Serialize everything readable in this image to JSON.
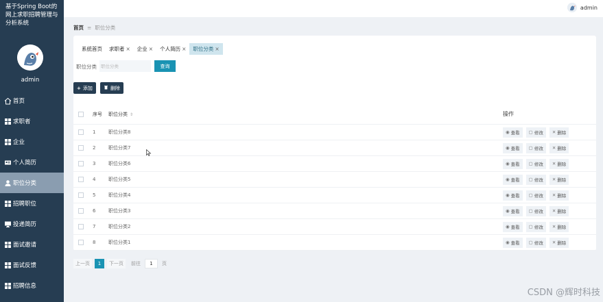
{
  "app": {
    "title": "基于Spring Boot的网上求职招聘管理与分析系统",
    "user_name": "admin",
    "header_user": "admin"
  },
  "sidebar": {
    "items": [
      {
        "label": "首页",
        "icon": "home-icon"
      },
      {
        "label": "求职者",
        "icon": "grid-icon"
      },
      {
        "label": "企业",
        "icon": "grid-icon"
      },
      {
        "label": "个人简历",
        "icon": "id-card-icon"
      },
      {
        "label": "职位分类",
        "icon": "user-icon"
      },
      {
        "label": "招聘职位",
        "icon": "grid-icon"
      },
      {
        "label": "投递简历",
        "icon": "monitor-icon"
      },
      {
        "label": "面试邀请",
        "icon": "grid-icon"
      },
      {
        "label": "面试反馈",
        "icon": "grid-icon"
      },
      {
        "label": "招聘信息",
        "icon": "grid-icon"
      }
    ],
    "active_index": 4
  },
  "breadcrumb": {
    "home": "首页",
    "separator": "≡",
    "current": "职位分类"
  },
  "tabs": [
    {
      "label": "系统首页",
      "closable": false
    },
    {
      "label": "求职者",
      "closable": true
    },
    {
      "label": "企业",
      "closable": true
    },
    {
      "label": "个人简历",
      "closable": true
    },
    {
      "label": "职位分类",
      "closable": true
    }
  ],
  "tab_close_glyph": "×",
  "search": {
    "label": "职位分类",
    "placeholder": "职位分类",
    "button": "查询"
  },
  "actions": {
    "add": "添加",
    "delete": "删除"
  },
  "table": {
    "headers": {
      "index": "序号",
      "name": "职位分类",
      "sort_glyph": "⇕",
      "ops": "操作"
    },
    "rows": [
      {
        "index": "1",
        "name": "职位分类8"
      },
      {
        "index": "2",
        "name": "职位分类7"
      },
      {
        "index": "3",
        "name": "职位分类6"
      },
      {
        "index": "4",
        "name": "职位分类5"
      },
      {
        "index": "5",
        "name": "职位分类4"
      },
      {
        "index": "6",
        "name": "职位分类3"
      },
      {
        "index": "7",
        "name": "职位分类2"
      },
      {
        "index": "8",
        "name": "职位分类1"
      }
    ],
    "row_ops": {
      "view": "查看",
      "edit": "修改",
      "delete": "删除"
    }
  },
  "pagination": {
    "prev": "上一页",
    "current": "1",
    "next": "下一页",
    "goto_prefix": "前往",
    "goto_value": "1",
    "goto_suffix": "页"
  },
  "watermark": "CSDN @辉时科技",
  "colors": {
    "sidebar_bg": "#263d52",
    "sidebar_active": "#8a9db0",
    "accent": "#1a93b3",
    "tab_active": "#cfe5ee"
  }
}
